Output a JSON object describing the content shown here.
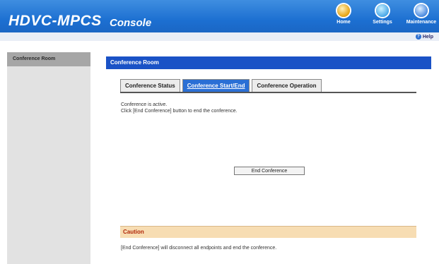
{
  "header": {
    "logo": "HDVC-MPCS",
    "subtitle": "Console",
    "nav": {
      "home": "Home",
      "settings": "Settings",
      "maintenance": "Maintenance"
    },
    "help": "Help"
  },
  "sidebar": {
    "items": [
      {
        "label": "Conference Room"
      }
    ]
  },
  "main": {
    "section_title": "Conference Room",
    "tabs": [
      {
        "label": "Conference Status"
      },
      {
        "label": "Conference Start/End"
      },
      {
        "label": "Conference Operation"
      }
    ],
    "active_tab": "Conference Start/End",
    "status_line1": "Conference is active.",
    "status_line2": "Click [End Conference] button to end the conference.",
    "end_button": "End Conference",
    "caution_title": "Caution",
    "caution_text": "[End Conference] will disconnect all endpoints and end the conference."
  },
  "colors": {
    "header_blue": "#1c6fd1",
    "section_header": "#1a52c6",
    "active_tab": "#2a6fd5",
    "caution_bg": "#f7ddb3",
    "caution_title": "#b0270a"
  },
  "icons": [
    "home-icon",
    "settings-icon",
    "maintenance-icon",
    "help-icon"
  ]
}
